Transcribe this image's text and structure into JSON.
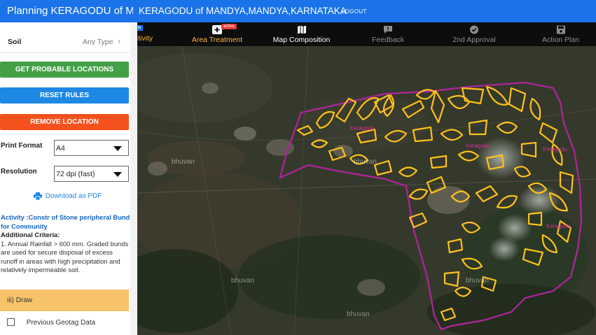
{
  "window": {
    "tab_title": "Planning KERAGODU of M..."
  },
  "header": {
    "title": "KERAGODU of MANDYA,MANDYA,KARNATAKA",
    "logout": "LOGOUT"
  },
  "toolbar": {
    "items": [
      {
        "label": "ctivity",
        "icon": "activity-icon",
        "badge": "me"
      },
      {
        "label": "Area Treatment",
        "icon": "plus-icon",
        "badge": "active",
        "active": true
      },
      {
        "label": "Map Composition",
        "icon": "map-icon"
      },
      {
        "label": "Feedback",
        "icon": "feedback-icon"
      },
      {
        "label": "2nd Approval",
        "icon": "check-circle-icon"
      },
      {
        "label": "Action Plan",
        "icon": "save-icon"
      }
    ]
  },
  "panel": {
    "soil_label": "Soil",
    "soil_value": "Any Type",
    "buttons": {
      "get_locations": "GET PROBABLE LOCATIONS",
      "reset_rules": "RESET RULES",
      "remove_location": "REMOVE LOCATION"
    },
    "print_format_label": "Print Format",
    "print_format_value": "A4",
    "resolution_label": "Resolution",
    "resolution_value": "72 dpi (fast)",
    "download": "Download as PDF",
    "activity_title": "Activity :Constr of Stone peripheral Bund for Community",
    "additional_criteria_label": "Additional Criteria:",
    "criteria_text": "1. Annual Rainfall > 600 mm. Graded bunds are used for secure disposal of excess runoff in areas with high precipitation and relatively impermeable soil.",
    "draw_label": "iii) Draw",
    "geotag_label": "Previous Geotag Data"
  },
  "map": {
    "watermark": "bhuvan",
    "colors": {
      "boundary": "#b0249c",
      "treatment": "#ffc21a"
    }
  },
  "colors": {
    "appbar": "#1a73e8",
    "toolbar": "#0d0d0d",
    "accent_orange": "#ffb13d"
  }
}
